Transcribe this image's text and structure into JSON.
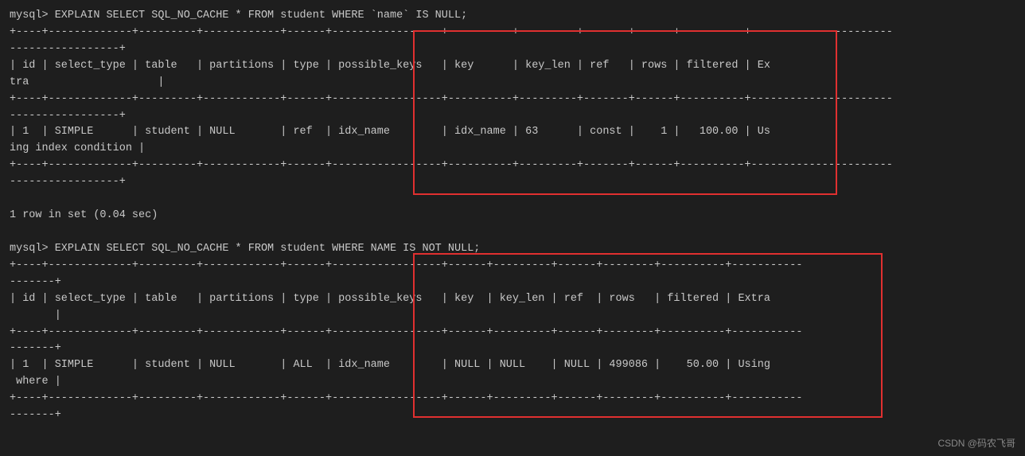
{
  "terminal": {
    "lines": [
      "mysql> EXPLAIN SELECT SQL_NO_CACHE * FROM student WHERE `name` IS NULL;",
      "+----+-------------+---------+------------+------+-----------------+----------+---------+-------+------+----------+-----------------------+",
      "| id | select_type | table   | partitions | type | possible_keys   | key      | key_len | ref   | rows | filtered | Ex",
      "tra                    |",
      "+----+-------------+---------+------------+------+-----------------+----------+---------+-------+------+----------+-----------------------+",
      "| 1  | SIMPLE      | student | NULL       | ref  | idx_name        | idx_name | 63      | const |    1 |   100.00 | Us",
      "ing index condition |",
      "+----+-------------+---------+------------+------+-----------------+----------+---------+-------+------+----------+-----------------------+",
      "",
      "1 row in set (0.04 sec)",
      "",
      "mysql> EXPLAIN SELECT SQL_NO_CACHE * FROM student WHERE NAME IS NOT NULL;",
      "+----+-------------+---------+------------+------+-----------------+------+---------+------+--------+----------+--------",
      "-------+",
      "| id | select_type | table   | partitions | type | possible_keys   | key  | key_len | ref  | rows   | filtered | Extra",
      "       |",
      "+----+-------------+---------+------------+------+-----------------+------+---------+------+--------+----------+--------",
      "-------+",
      "| 1  | SIMPLE      | student | NULL       | ALL  | idx_name        | NULL | NULL    | NULL | 499086 |    50.00 | Using",
      " where |",
      "+----+-------------+---------+------------+------+-----------------+------+---------+------+--------+----------+--------",
      "-------+"
    ],
    "watermark": "CSDN @码农飞哥"
  }
}
